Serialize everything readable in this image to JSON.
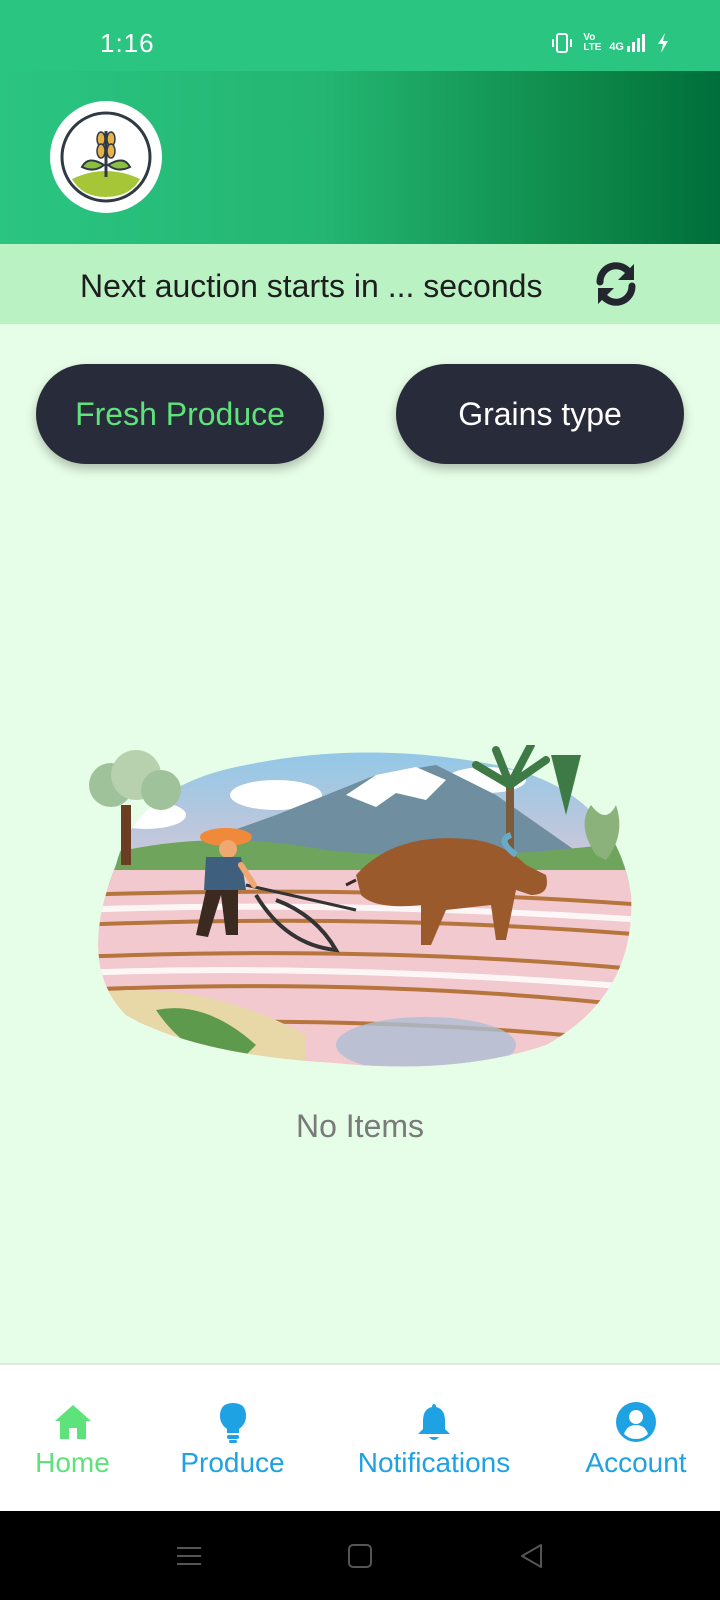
{
  "status_bar": {
    "time": "1:16",
    "network_label": "4G",
    "volte_label": "Vo LTE",
    "icons": [
      "vibrate-icon",
      "volte-icon",
      "signal-4g-icon",
      "charging-icon"
    ]
  },
  "header": {
    "logo_icon": "wheat-logo-icon",
    "colors": {
      "start": "#2ac581",
      "end": "#006e3a"
    }
  },
  "countdown": {
    "text": "Next auction starts in ... seconds",
    "refresh_icon": "refresh-icon"
  },
  "filters": [
    {
      "label": "Fresh Produce",
      "selected": true
    },
    {
      "label": "Grains type",
      "selected": false
    }
  ],
  "empty_state": {
    "illustration": "farmer-plowing-with-ox-illustration",
    "message": "No Items"
  },
  "bottom_nav": {
    "items": [
      {
        "label": "Home",
        "icon": "home-icon",
        "active": true
      },
      {
        "label": "Produce",
        "icon": "lightbulb-icon",
        "active": false
      },
      {
        "label": "Notifications",
        "icon": "bell-icon",
        "active": false
      },
      {
        "label": "Account",
        "icon": "account-icon",
        "active": false
      }
    ],
    "active_color": "#5ee27a",
    "inactive_color": "#1ea2e4"
  },
  "system_nav": {
    "buttons": [
      "menu-icon",
      "home-square-icon",
      "back-triangle-icon"
    ]
  }
}
